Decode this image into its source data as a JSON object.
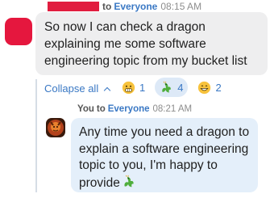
{
  "message": {
    "to_label": "to",
    "recipient": "Everyone",
    "time": "08:15 AM",
    "text": "So now I can check a dragon explaining me some software engineering topic from my bucket list"
  },
  "thread": {
    "collapse_label": "Collapse all"
  },
  "reactions": [
    {
      "icon": "grimace-emoji-icon",
      "count": "1"
    },
    {
      "icon": "dragon-emoji-icon",
      "count": "4"
    },
    {
      "icon": "grin-emoji-icon",
      "count": "2"
    }
  ],
  "reply": {
    "sender": "You",
    "to_label": "to",
    "recipient": "Everyone",
    "time": "08:21 AM",
    "text": "Any time you need a dragon to explain a software engineering topic to you, I'm happy to provide",
    "trailing_icon": "dragon-emoji-icon"
  },
  "colors": {
    "accent": "#3a78c4",
    "sender_redacted": "#e11d3f",
    "bubble_gray": "#eeeeef",
    "bubble_blue": "#e4effa"
  }
}
